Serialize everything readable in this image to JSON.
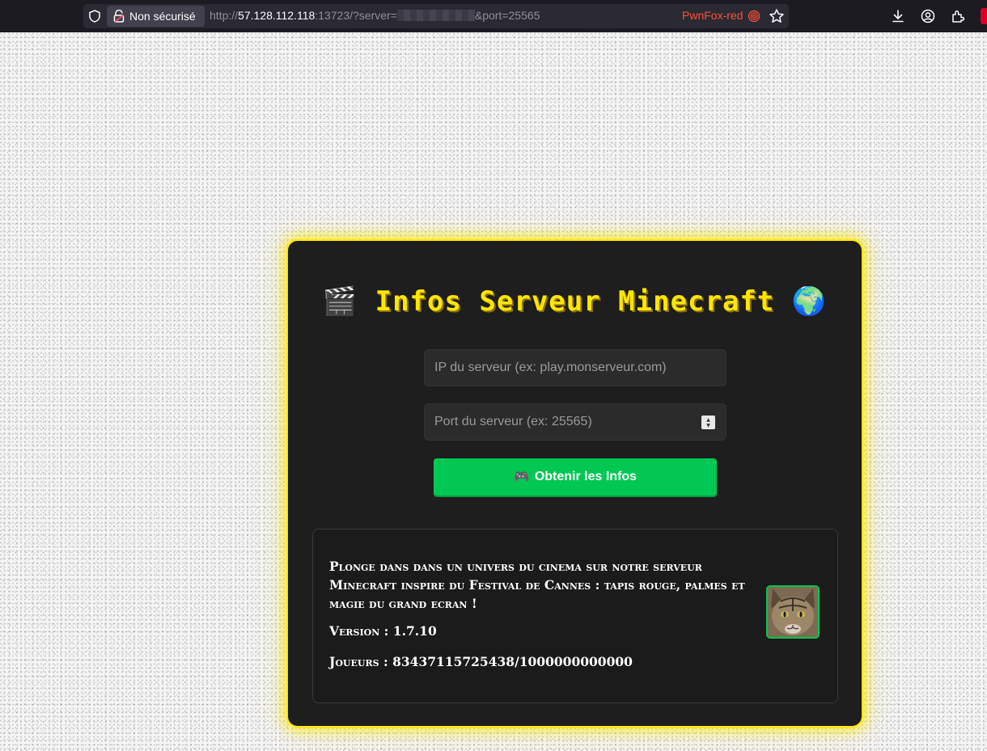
{
  "browser": {
    "security_label": "Non sécurisé",
    "url_prefix": "http://",
    "url_host": "57.128.112.118",
    "url_path": ":13723/?server=",
    "url_suffix": "&port=25565",
    "container_label": "PwnFox-red",
    "icons": [
      "shield-icon",
      "unlock-icon",
      "fingerprint-icon",
      "star-icon",
      "download-icon",
      "account-icon",
      "extensions-icon"
    ]
  },
  "card": {
    "title_emoji_left": "🎬",
    "title_text": "Infos Serveur Minecraft",
    "title_emoji_right": "🌍",
    "ip_placeholder": "IP du serveur (ex: play.monserveur.com)",
    "port_placeholder": "Port du serveur (ex: 25565)",
    "button_emoji": "🎮",
    "button_label": "Obtenir les Infos",
    "accent_color": "#ffe600",
    "button_color": "#00c853"
  },
  "server_info": {
    "motd": "Plonge dans dans un univers du cinema sur notre serveur Minecraft inspire du Festival de Cannes : tapis rouge, palmes et magie du grand ecran !",
    "version_line": "Version : 1.7.10",
    "players_line": "Joueurs : 83437115725438/1000000000000",
    "icon": "cat-favicon"
  }
}
